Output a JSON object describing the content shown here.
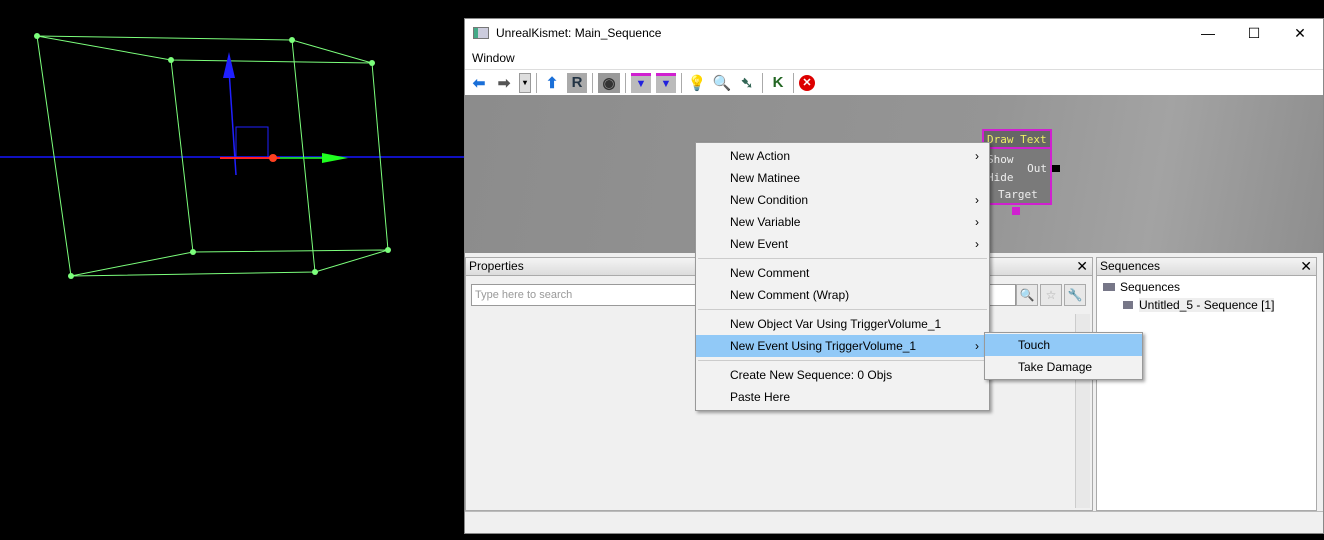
{
  "window": {
    "title": "UnrealKismet: Main_Sequence",
    "minimize": "—",
    "maximize": "☐",
    "close": "✕"
  },
  "menubar": {
    "items": [
      "Window"
    ]
  },
  "toolbar": {
    "icons": [
      "back-arrow",
      "forward-arrow",
      "history-dropdown",
      "parent-sequence",
      "rename",
      "toggle-visibility",
      "create-sequence",
      "create-sequence-object",
      "hint",
      "search",
      "open-referenced",
      "kismet-debug",
      "delete"
    ]
  },
  "node": {
    "title": "Draw Text",
    "inputs": [
      "Show",
      "Hide"
    ],
    "output": "Out",
    "variable": "Target"
  },
  "properties": {
    "title": "Properties",
    "search_placeholder": "Type here to search"
  },
  "sequences": {
    "title": "Sequences",
    "root": "Sequences",
    "child": "Untitled_5 - Sequence [1]"
  },
  "context_menu": {
    "items": [
      {
        "label": "New Action",
        "submenu": true
      },
      {
        "label": "New Matinee"
      },
      {
        "label": "New Condition",
        "submenu": true
      },
      {
        "label": "New Variable",
        "submenu": true
      },
      {
        "label": "New Event",
        "submenu": true
      },
      {
        "sep": true
      },
      {
        "label": "New Comment"
      },
      {
        "label": "New Comment (Wrap)"
      },
      {
        "sep": true
      },
      {
        "label": "New Object Var Using TriggerVolume_1"
      },
      {
        "label": "New Event Using TriggerVolume_1",
        "submenu": true,
        "highlighted": true
      },
      {
        "sep": true
      },
      {
        "label": "Create New Sequence: 0 Objs"
      },
      {
        "label": "Paste Here"
      }
    ]
  },
  "submenu": {
    "items": [
      {
        "label": "Touch",
        "highlighted": true
      },
      {
        "label": "Take Damage"
      }
    ]
  },
  "colors": {
    "node_border": "#d020d0",
    "highlight": "#91c9f7",
    "wire": "#7cff7c"
  }
}
